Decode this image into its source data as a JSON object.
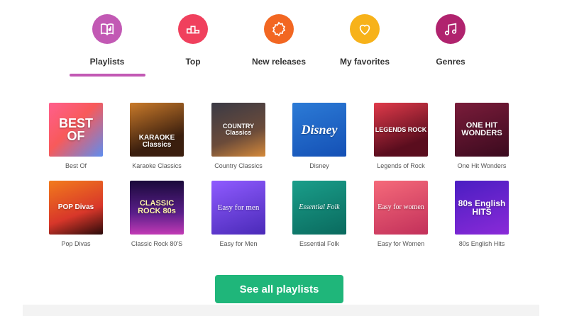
{
  "tabs": [
    {
      "label": "Playlists",
      "icon": "book-music-icon",
      "color": "#c259b4"
    },
    {
      "label": "Top",
      "icon": "podium-icon",
      "color": "#f0405d"
    },
    {
      "label": "New releases",
      "icon": "badge-new-icon",
      "color": "#f26722"
    },
    {
      "label": "My favorites",
      "icon": "heart-icon",
      "color": "#f7b21a"
    },
    {
      "label": "Genres",
      "icon": "music-notes-icon",
      "color": "#b0236e"
    }
  ],
  "active_tab": "Playlists",
  "playlists": [
    {
      "caption": "Best Of",
      "art": "BEST OF",
      "bg": "linear-gradient(135deg,#ff5f8d,#f85a5a 45%,#5d8df0)"
    },
    {
      "caption": "Karaoke Classics",
      "art": "KARAOKE Classics",
      "bg": "linear-gradient(160deg,#c97a2a,#3a1e0e 70%)"
    },
    {
      "caption": "Country Classics",
      "art": "COUNTRY Classics",
      "bg": "linear-gradient(160deg,#3a3a45,#6b4b3a 60%,#d68a3a)"
    },
    {
      "caption": "Disney",
      "art": "Disney",
      "bg": "linear-gradient(160deg,#2c7bd6,#1450b5)"
    },
    {
      "caption": "Legends of Rock",
      "art": "LEGENDS ROCK",
      "bg": "linear-gradient(160deg,#e03a4a,#5a0d1e 75%)"
    },
    {
      "caption": "One Hit Wonders",
      "art": "ONE HIT WONDERS",
      "bg": "linear-gradient(160deg,#7a1c3a,#3a0a1e)"
    },
    {
      "caption": "Pop Divas",
      "art": "POP Divas",
      "bg": "linear-gradient(160deg,#f27b1c,#d8372a 60%,#2a0a0a)"
    },
    {
      "caption": "Classic Rock 80'S",
      "art": "CLASSIC ROCK 80s",
      "bg": "linear-gradient(180deg,#1a0a3a,#5a1e8a 60%,#c23ab5)"
    },
    {
      "caption": "Easy for Men",
      "art": "Easy for men",
      "bg": "linear-gradient(160deg,#8f5bff,#4a2ab8)"
    },
    {
      "caption": "Essential Folk",
      "art": "Essential Folk",
      "bg": "linear-gradient(160deg,#1a9e8a,#0a6a5e)"
    },
    {
      "caption": "Easy for Women",
      "art": "Easy for women",
      "bg": "linear-gradient(160deg,#f56a7a,#c2305a)"
    },
    {
      "caption": "80s English Hits",
      "art": "80s English HITS",
      "bg": "linear-gradient(160deg,#4a1ec2,#8a2ad8)"
    }
  ],
  "cta_label": "See all playlists"
}
